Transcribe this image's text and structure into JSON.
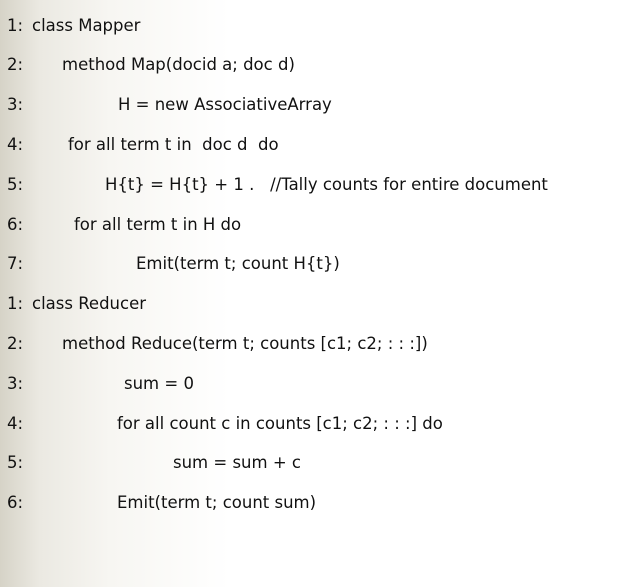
{
  "mapper": {
    "lines": [
      {
        "num": "1:",
        "text": "class Mapper"
      },
      {
        "num": "2:",
        "text": "method Map(docid a; doc d)"
      },
      {
        "num": "3:",
        "text": "H = new AssociativeArray"
      },
      {
        "num": "4:",
        "text": "for all term t in  doc d  do"
      },
      {
        "num": "5:",
        "text": "H{t} = H{t} + 1 .   //Tally counts for entire document"
      },
      {
        "num": "6:",
        "text": "for all term t in H do"
      },
      {
        "num": "7:",
        "text": "Emit(term t; count H{t})"
      }
    ]
  },
  "reducer": {
    "lines": [
      {
        "num": "1:",
        "text": "class Reducer"
      },
      {
        "num": "2:",
        "text": "method Reduce(term t; counts [c1; c2; : : :])"
      },
      {
        "num": "3:",
        "text": "sum = 0"
      },
      {
        "num": "4:",
        "text": "for all count c in counts [c1; c2; : : :] do"
      },
      {
        "num": "5:",
        "text": "sum = sum + c"
      },
      {
        "num": "6:",
        "text": "Emit(term t; count sum)"
      }
    ]
  }
}
